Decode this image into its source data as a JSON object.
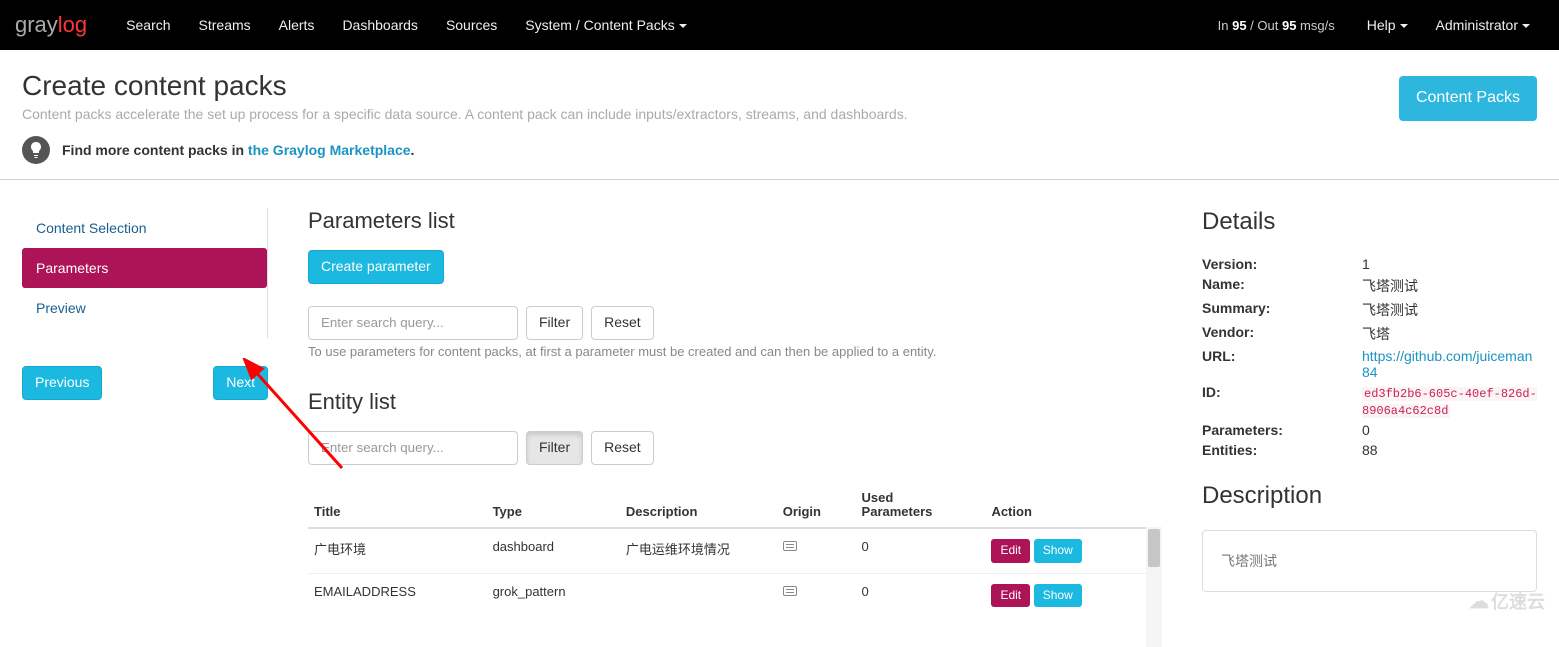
{
  "navbar": {
    "brand_gray": "gray",
    "brand_log": "log",
    "items": [
      "Search",
      "Streams",
      "Alerts",
      "Dashboards",
      "Sources",
      "System / Content Packs"
    ],
    "throughput_prefix": "In ",
    "throughput_in": "95",
    "throughput_mid": " / Out ",
    "throughput_out": "95",
    "throughput_suffix": " msg/s",
    "help": "Help",
    "admin": "Administrator"
  },
  "header": {
    "title": "Create content packs",
    "subtitle": "Content packs accelerate the set up process for a specific data source. A content pack can include inputs/extractors, streams, and dashboards.",
    "action_button": "Content Packs",
    "info_prefix": "Find more content packs in ",
    "info_link": "the Graylog Marketplace",
    "info_suffix": "."
  },
  "wizard": {
    "steps": [
      "Content Selection",
      "Parameters",
      "Preview"
    ],
    "active_index": 1,
    "prev": "Previous",
    "next": "Next"
  },
  "params": {
    "title": "Parameters list",
    "create_btn": "Create parameter",
    "search_placeholder": "Enter search query...",
    "filter": "Filter",
    "reset": "Reset",
    "help": "To use parameters for content packs, at first a parameter must be created and can then be applied to a entity."
  },
  "entities": {
    "title": "Entity list",
    "search_placeholder": "Enter search query...",
    "filter": "Filter",
    "reset": "Reset",
    "columns": [
      "Title",
      "Type",
      "Description",
      "Origin",
      "Used Parameters",
      "Action"
    ],
    "edit": "Edit",
    "show": "Show",
    "rows": [
      {
        "title": "广电环境",
        "type": "dashboard",
        "description": "广电运维环境情况",
        "used": "0"
      },
      {
        "title": "EMAILADDRESS",
        "type": "grok_pattern",
        "description": "",
        "used": "0"
      }
    ]
  },
  "details": {
    "title": "Details",
    "fields": {
      "version_label": "Version:",
      "version": "1",
      "name_label": "Name:",
      "name": "飞塔测试",
      "summary_label": "Summary:",
      "summary": "飞塔测试",
      "vendor_label": "Vendor:",
      "vendor": "飞塔",
      "url_label": "URL:",
      "url": "https://github.com/juiceman84",
      "id_label": "ID:",
      "id": "ed3fb2b6-605c-40ef-826d-8906a4c62c8d",
      "parameters_label": "Parameters:",
      "parameters": "0",
      "entities_label": "Entities:",
      "entities": "88"
    },
    "description_title": "Description",
    "description_body": "飞塔测试"
  },
  "watermark": "亿速云"
}
